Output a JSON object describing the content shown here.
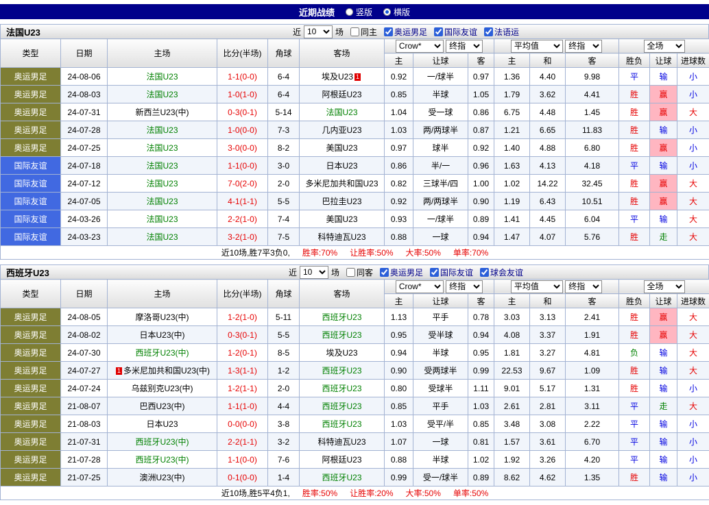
{
  "colors": {
    "topbar_bg": "#00008b",
    "focus_team_green": "#008000",
    "score_red": "#e60000",
    "result_win_red": "#e60000",
    "result_lose_blue": "#0000e0",
    "result_push_green": "#008000",
    "win_highlight_bg": "#ffb6c1",
    "type_olympic_bg": "#7e7e33",
    "type_friendly_bg": "#4169e1"
  },
  "page": {
    "title": "近期战绩",
    "view_options": [
      {
        "label": "竖版",
        "selected": false
      },
      {
        "label": "横版",
        "selected": true
      }
    ]
  },
  "columns": {
    "type": "类型",
    "date": "日期",
    "home": "主场",
    "score": "比分(半场)",
    "corner": "角球",
    "away": "客场",
    "odds_group": {
      "selects": [
        "Crow*",
        "终指"
      ],
      "sub": [
        "主",
        "让球",
        "客"
      ]
    },
    "avg_group": {
      "selects": [
        "平均值",
        "终指"
      ],
      "sub": [
        "主",
        "和",
        "客"
      ]
    },
    "result_group": {
      "selects": [
        "全场"
      ],
      "sub": [
        "胜负",
        "让球",
        "进球数"
      ]
    }
  },
  "sections": [
    {
      "team": "法国U23",
      "filter": {
        "near_label": "近",
        "count": "10",
        "games_label": "场",
        "checkboxes": [
          {
            "label": "同主",
            "checked": false,
            "link": false
          },
          {
            "label": "奥运男足",
            "checked": true,
            "link": true
          },
          {
            "label": "国际友谊",
            "checked": true,
            "link": true
          },
          {
            "label": "法语运",
            "checked": true,
            "link": true
          }
        ]
      },
      "rows": [
        {
          "type": "奥运男足",
          "date": "24-08-06",
          "home": {
            "name": "法国U23"
          },
          "score": "1-1(0-0)",
          "corner": "6-4",
          "away": {
            "name": "埃及U23",
            "red": "1",
            "red_pos": "after"
          },
          "odds": [
            "0.92",
            "一/球半",
            "0.97"
          ],
          "avg": [
            "1.36",
            "4.40",
            "9.98"
          ],
          "result": [
            "平",
            "输",
            "小"
          ]
        },
        {
          "type": "奥运男足",
          "date": "24-08-03",
          "home": {
            "name": "法国U23"
          },
          "score": "1-0(1-0)",
          "corner": "6-4",
          "away": {
            "name": "阿根廷U23"
          },
          "odds": [
            "0.85",
            "半球",
            "1.05"
          ],
          "avg": [
            "1.79",
            "3.62",
            "4.41"
          ],
          "result": [
            "胜",
            "赢",
            "小"
          ]
        },
        {
          "type": "奥运男足",
          "date": "24-07-31",
          "home": {
            "name": "新西兰U23(中)"
          },
          "score": "0-3(0-1)",
          "corner": "5-14",
          "away": {
            "name": "法国U23"
          },
          "odds": [
            "1.04",
            "受一球",
            "0.86"
          ],
          "avg": [
            "6.75",
            "4.48",
            "1.45"
          ],
          "result": [
            "胜",
            "赢",
            "大"
          ]
        },
        {
          "type": "奥运男足",
          "date": "24-07-28",
          "home": {
            "name": "法国U23"
          },
          "score": "1-0(0-0)",
          "corner": "7-3",
          "away": {
            "name": "几内亚U23"
          },
          "odds": [
            "1.03",
            "两/两球半",
            "0.87"
          ],
          "avg": [
            "1.21",
            "6.65",
            "11.83"
          ],
          "result": [
            "胜",
            "输",
            "小"
          ]
        },
        {
          "type": "奥运男足",
          "date": "24-07-25",
          "home": {
            "name": "法国U23"
          },
          "score": "3-0(0-0)",
          "corner": "8-2",
          "away": {
            "name": "美国U23"
          },
          "odds": [
            "0.97",
            "球半",
            "0.92"
          ],
          "avg": [
            "1.40",
            "4.88",
            "6.80"
          ],
          "result": [
            "胜",
            "赢",
            "小"
          ]
        },
        {
          "type": "国际友谊",
          "date": "24-07-18",
          "home": {
            "name": "法国U23"
          },
          "score": "1-1(0-0)",
          "corner": "3-0",
          "away": {
            "name": "日本U23"
          },
          "odds": [
            "0.86",
            "半/一",
            "0.96"
          ],
          "avg": [
            "1.63",
            "4.13",
            "4.18"
          ],
          "result": [
            "平",
            "输",
            "小"
          ]
        },
        {
          "type": "国际友谊",
          "date": "24-07-12",
          "home": {
            "name": "法国U23"
          },
          "score": "7-0(2-0)",
          "corner": "2-0",
          "away": {
            "name": "多米尼加共和国U23"
          },
          "odds": [
            "0.82",
            "三球半/四",
            "1.00"
          ],
          "avg": [
            "1.02",
            "14.22",
            "32.45"
          ],
          "result": [
            "胜",
            "赢",
            "大"
          ]
        },
        {
          "type": "国际友谊",
          "date": "24-07-05",
          "home": {
            "name": "法国U23"
          },
          "score": "4-1(1-1)",
          "corner": "5-5",
          "away": {
            "name": "巴拉圭U23"
          },
          "odds": [
            "0.92",
            "两/两球半",
            "0.90"
          ],
          "avg": [
            "1.19",
            "6.43",
            "10.51"
          ],
          "result": [
            "胜",
            "赢",
            "大"
          ]
        },
        {
          "type": "国际友谊",
          "date": "24-03-26",
          "home": {
            "name": "法国U23"
          },
          "score": "2-2(1-0)",
          "corner": "7-4",
          "away": {
            "name": "美国U23"
          },
          "odds": [
            "0.93",
            "一/球半",
            "0.89"
          ],
          "avg": [
            "1.41",
            "4.45",
            "6.04"
          ],
          "result": [
            "平",
            "输",
            "大"
          ]
        },
        {
          "type": "国际友谊",
          "date": "24-03-23",
          "home": {
            "name": "法国U23"
          },
          "score": "3-2(1-0)",
          "corner": "7-5",
          "away": {
            "name": "科特迪瓦U23"
          },
          "odds": [
            "0.88",
            "一球",
            "0.94"
          ],
          "avg": [
            "1.47",
            "4.07",
            "5.76"
          ],
          "result": [
            "胜",
            "走",
            "大"
          ]
        }
      ],
      "summary": {
        "lead": "近10场,胜7平3负0,",
        "stats": [
          "胜率:70%",
          "让胜率:50%",
          "大率:50%",
          "单率:70%"
        ]
      }
    },
    {
      "team": "西班牙U23",
      "filter": {
        "near_label": "近",
        "count": "10",
        "games_label": "场",
        "checkboxes": [
          {
            "label": "同客",
            "checked": false,
            "link": false
          },
          {
            "label": "奥运男足",
            "checked": true,
            "link": true
          },
          {
            "label": "国际友谊",
            "checked": true,
            "link": true
          },
          {
            "label": "球会友谊",
            "checked": true,
            "link": true
          }
        ]
      },
      "rows": [
        {
          "type": "奥运男足",
          "date": "24-08-05",
          "home": {
            "name": "摩洛哥U23(中)"
          },
          "score": "1-2(1-0)",
          "corner": "5-11",
          "away": {
            "name": "西班牙U23"
          },
          "odds": [
            "1.13",
            "平手",
            "0.78"
          ],
          "avg": [
            "3.03",
            "3.13",
            "2.41"
          ],
          "result": [
            "胜",
            "赢",
            "大"
          ]
        },
        {
          "type": "奥运男足",
          "date": "24-08-02",
          "home": {
            "name": "日本U23(中)"
          },
          "score": "0-3(0-1)",
          "corner": "5-5",
          "away": {
            "name": "西班牙U23"
          },
          "odds": [
            "0.95",
            "受半球",
            "0.94"
          ],
          "avg": [
            "4.08",
            "3.37",
            "1.91"
          ],
          "result": [
            "胜",
            "赢",
            "大"
          ]
        },
        {
          "type": "奥运男足",
          "date": "24-07-30",
          "home": {
            "name": "西班牙U23(中)"
          },
          "score": "1-2(0-1)",
          "corner": "8-5",
          "away": {
            "name": "埃及U23"
          },
          "odds": [
            "0.94",
            "半球",
            "0.95"
          ],
          "avg": [
            "1.81",
            "3.27",
            "4.81"
          ],
          "result": [
            "负",
            "输",
            "大"
          ]
        },
        {
          "type": "奥运男足",
          "date": "24-07-27",
          "home": {
            "name": "多米尼加共和国U23(中)",
            "red": "1",
            "red_pos": "before"
          },
          "score": "1-3(1-1)",
          "corner": "1-2",
          "away": {
            "name": "西班牙U23"
          },
          "odds": [
            "0.90",
            "受两球半",
            "0.99"
          ],
          "avg": [
            "22.53",
            "9.67",
            "1.09"
          ],
          "result": [
            "胜",
            "输",
            "大"
          ]
        },
        {
          "type": "奥运男足",
          "date": "24-07-24",
          "home": {
            "name": "乌兹别克U23(中)"
          },
          "score": "1-2(1-1)",
          "corner": "2-0",
          "away": {
            "name": "西班牙U23"
          },
          "odds": [
            "0.80",
            "受球半",
            "1.11"
          ],
          "avg": [
            "9.01",
            "5.17",
            "1.31"
          ],
          "result": [
            "胜",
            "输",
            "小"
          ]
        },
        {
          "type": "奥运男足",
          "date": "21-08-07",
          "home": {
            "name": "巴西U23(中)"
          },
          "score": "1-1(1-0)",
          "corner": "4-4",
          "away": {
            "name": "西班牙U23"
          },
          "odds": [
            "0.85",
            "平手",
            "1.03"
          ],
          "avg": [
            "2.61",
            "2.81",
            "3.11"
          ],
          "result": [
            "平",
            "走",
            "大"
          ]
        },
        {
          "type": "奥运男足",
          "date": "21-08-03",
          "home": {
            "name": "日本U23"
          },
          "score": "0-0(0-0)",
          "corner": "3-8",
          "away": {
            "name": "西班牙U23"
          },
          "odds": [
            "1.03",
            "受平/半",
            "0.85"
          ],
          "avg": [
            "3.48",
            "3.08",
            "2.22"
          ],
          "result": [
            "平",
            "输",
            "小"
          ]
        },
        {
          "type": "奥运男足",
          "date": "21-07-31",
          "home": {
            "name": "西班牙U23(中)"
          },
          "score": "2-2(1-1)",
          "corner": "3-2",
          "away": {
            "name": "科特迪瓦U23"
          },
          "odds": [
            "1.07",
            "一球",
            "0.81"
          ],
          "avg": [
            "1.57",
            "3.61",
            "6.70"
          ],
          "result": [
            "平",
            "输",
            "小"
          ]
        },
        {
          "type": "奥运男足",
          "date": "21-07-28",
          "home": {
            "name": "西班牙U23(中)"
          },
          "score": "1-1(0-0)",
          "corner": "7-6",
          "away": {
            "name": "阿根廷U23"
          },
          "odds": [
            "0.88",
            "半球",
            "1.02"
          ],
          "avg": [
            "1.92",
            "3.26",
            "4.20"
          ],
          "result": [
            "平",
            "输",
            "小"
          ]
        },
        {
          "type": "奥运男足",
          "date": "21-07-25",
          "home": {
            "name": "澳洲U23(中)"
          },
          "score": "0-1(0-0)",
          "corner": "1-4",
          "away": {
            "name": "西班牙U23"
          },
          "odds": [
            "0.99",
            "受一/球半",
            "0.89"
          ],
          "avg": [
            "8.62",
            "4.62",
            "1.35"
          ],
          "result": [
            "胜",
            "输",
            "小"
          ]
        }
      ],
      "summary": {
        "lead": "近10场,胜5平4负1,",
        "stats": [
          "胜率:50%",
          "让胜率:20%",
          "大率:50%",
          "单率:50%"
        ]
      }
    }
  ]
}
